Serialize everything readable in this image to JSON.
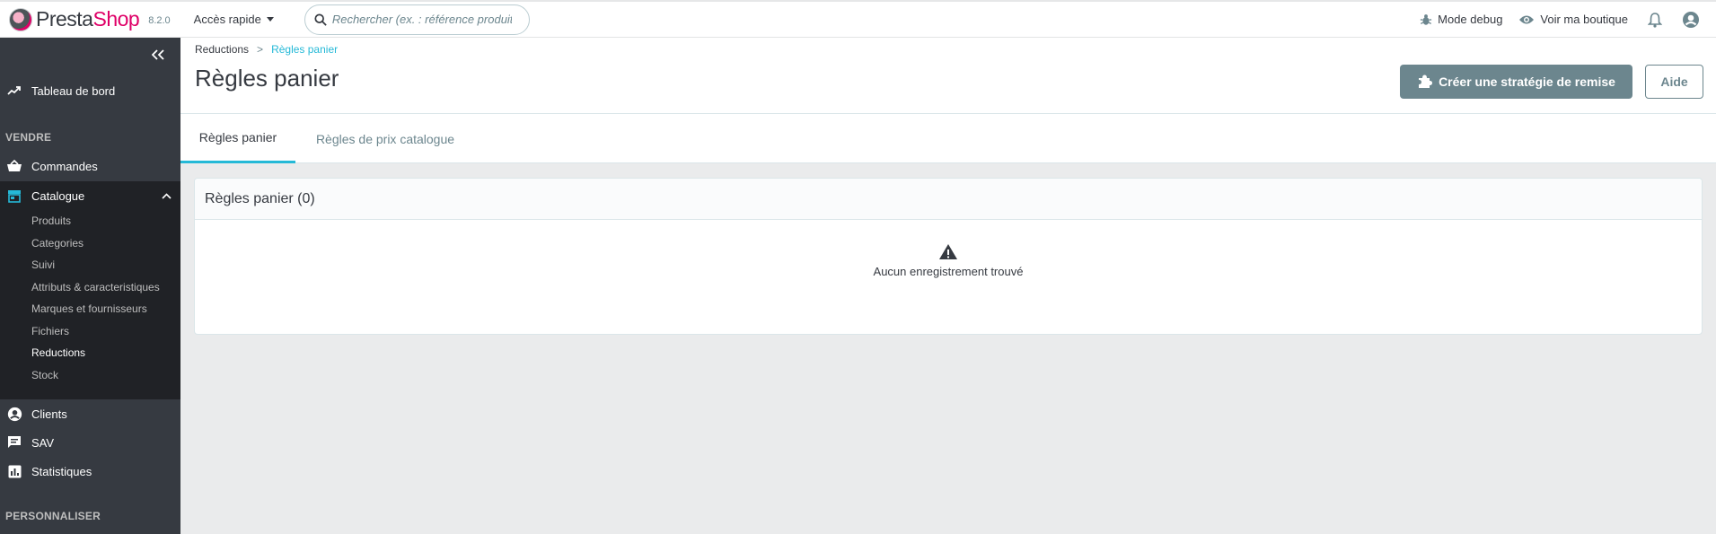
{
  "header": {
    "logo_presta": "Presta",
    "logo_shop": "Shop",
    "version": "8.2.0",
    "quick_access": "Accès rapide",
    "search_placeholder": "Rechercher (ex. : référence produit, no",
    "debug_mode": "Mode debug",
    "view_shop": "Voir ma boutique"
  },
  "sidebar": {
    "dashboard": "Tableau de bord",
    "section_sell": "VENDRE",
    "orders": "Commandes",
    "catalogue": "Catalogue",
    "catalogue_items": [
      "Produits",
      "Categories",
      "Suivi",
      "Attributs & caracteristiques",
      "Marques et fournisseurs",
      "Fichiers",
      "Reductions",
      "Stock"
    ],
    "active_sub_item": "Reductions",
    "clients": "Clients",
    "sav": "SAV",
    "stats": "Statistiques",
    "section_customize": "PERSONNALISER"
  },
  "breadcrumb": {
    "parent": "Reductions",
    "separator": ">",
    "current": "Règles panier"
  },
  "page": {
    "title": "Règles panier",
    "create_button": "Créer une stratégie de remise",
    "help_button": "Aide"
  },
  "tabs": [
    {
      "label": "Règles panier",
      "active": true
    },
    {
      "label": "Règles de prix catalogue",
      "active": false
    }
  ],
  "card": {
    "title": "Règles panier (0)",
    "empty_message": "Aucun enregistrement trouvé"
  },
  "colors": {
    "accent": "#25b9d7",
    "brand": "#df0067",
    "sidebar_bg": "#363a41",
    "sidebar_active_bg": "#202226",
    "button_dark": "#6c868e"
  }
}
